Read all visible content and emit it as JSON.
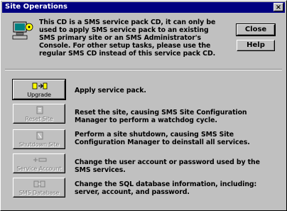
{
  "window": {
    "title": "Site Operations",
    "close_glyph": "×"
  },
  "intro": {
    "icon": "sms-setup-computer-icon",
    "text": "This CD is a SMS service pack CD, it can only be used to apply SMS service pack to an existing SMS primary site or an SMS Administrator's Console.  For other setup tasks, please use the regular SMS CD instead of this service pack CD."
  },
  "buttons": {
    "close": "Close",
    "help": "Help"
  },
  "actions": [
    {
      "label": "Upgrade",
      "icon": "upgrade-icon",
      "enabled": true,
      "description": "Apply service pack."
    },
    {
      "label": "Reset Site",
      "icon": "reset-site-icon",
      "enabled": false,
      "description": "Reset the site, causing SMS Site Configuration Manager to perform a watchdog cycle."
    },
    {
      "label": "Shutdown Site",
      "icon": "shutdown-site-icon",
      "enabled": false,
      "description": "Perform a site shutdown, causing SMS Site Configuration Manager to deinstall all services."
    },
    {
      "label": "Service Account",
      "icon": "service-account-icon",
      "enabled": false,
      "description": "Change the user account or password used by the SMS services."
    },
    {
      "label": "SMS Database",
      "icon": "sms-database-icon",
      "enabled": false,
      "description": "Change the SQL database information, including: server, account, and password."
    }
  ],
  "colors": {
    "titlebar": "#000080",
    "face": "#c0c0c0",
    "disabled_text": "#808080"
  }
}
